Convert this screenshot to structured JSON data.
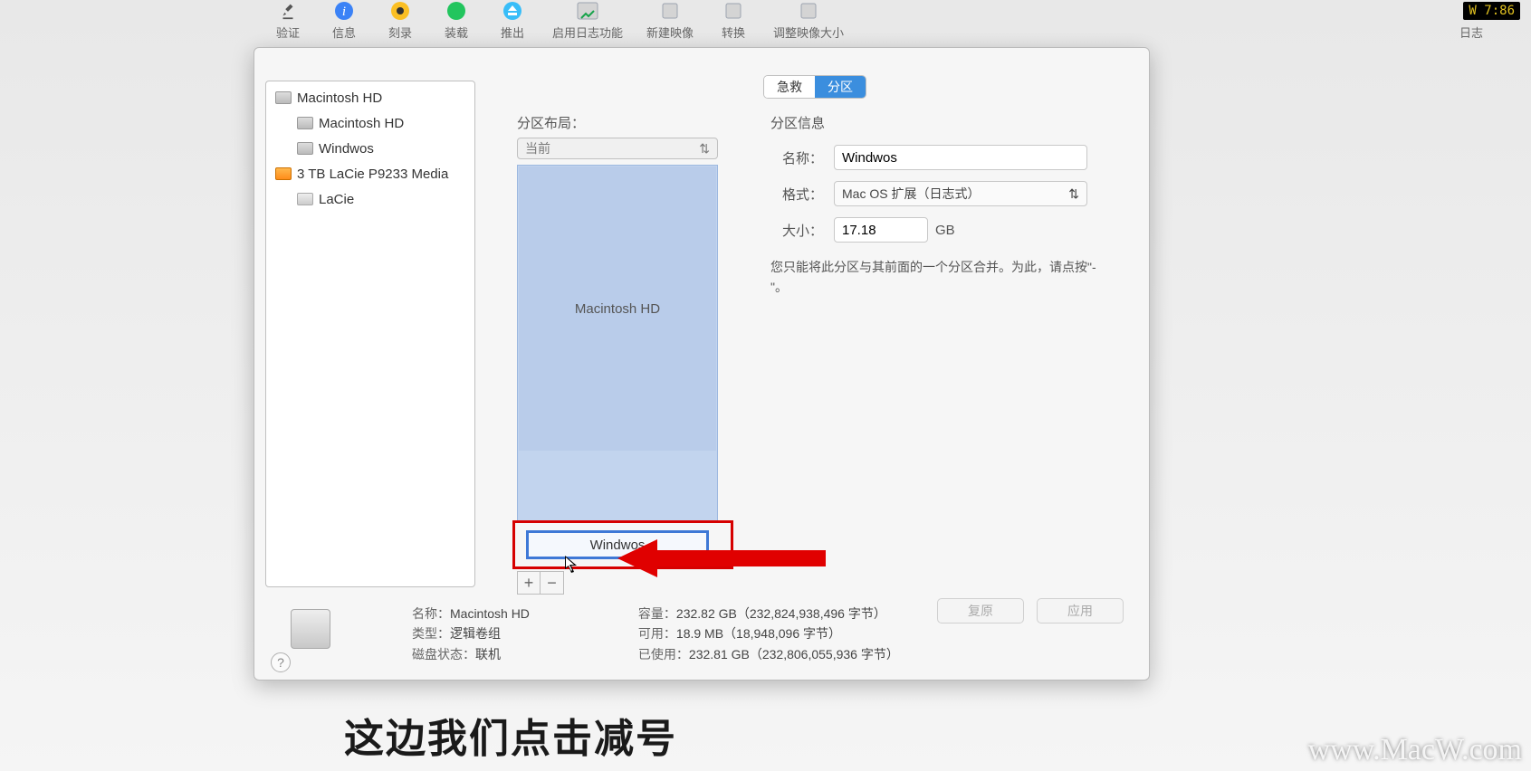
{
  "toolbar": {
    "items": [
      {
        "label": "验证"
      },
      {
        "label": "信息"
      },
      {
        "label": "刻录"
      },
      {
        "label": "装载"
      },
      {
        "label": "推出"
      },
      {
        "label": "启用日志功能"
      },
      {
        "label": "新建映像"
      },
      {
        "label": "转换"
      },
      {
        "label": "调整映像大小"
      }
    ],
    "right": {
      "label": "日志"
    }
  },
  "clock": "W 7:86",
  "sidebar": {
    "items": [
      {
        "label": "Macintosh HD",
        "icon": "hd-gray",
        "indent": 0
      },
      {
        "label": "Macintosh HD",
        "icon": "hd-gray",
        "indent": 1
      },
      {
        "label": "Windwos",
        "icon": "hd-gray",
        "indent": 1
      },
      {
        "label": "3 TB LaCie P9233 Media",
        "icon": "hd-orange",
        "indent": 0
      },
      {
        "label": "LaCie",
        "icon": "hd-silver",
        "indent": 1
      }
    ]
  },
  "tabs": {
    "first": "急救",
    "second": "分区"
  },
  "layout": {
    "title": "分区布局：",
    "select": "当前",
    "main_part": "Macintosh HD",
    "sel_part": "Windwos",
    "add": "+",
    "remove": "−"
  },
  "info": {
    "title": "分区信息",
    "name_label": "名称：",
    "name": "Windwos",
    "fmt_label": "格式：",
    "fmt": "Mac OS 扩展（日志式）",
    "size_label": "大小：",
    "size": "17.18",
    "unit": "GB",
    "hint": "您只能将此分区与其前面的一个分区合并。为此，请点按\"-\"。"
  },
  "footer": {
    "revert": "复原",
    "apply": "应用"
  },
  "disk": {
    "name_l": "名称：",
    "name": "Macintosh HD",
    "type_l": "类型：",
    "type": "逻辑卷组",
    "status_l": "磁盘状态：",
    "status": "联机",
    "cap_l": "容量：",
    "cap": "232.82 GB（232,824,938,496 字节）",
    "free_l": "可用：",
    "free": "18.9 MB（18,948,096 字节）",
    "used_l": "已使用：",
    "used": "232.81 GB（232,806,055,936 字节）"
  },
  "subtitle": "这边我们点击减号",
  "watermark": "www.MacW.com",
  "help": "?"
}
